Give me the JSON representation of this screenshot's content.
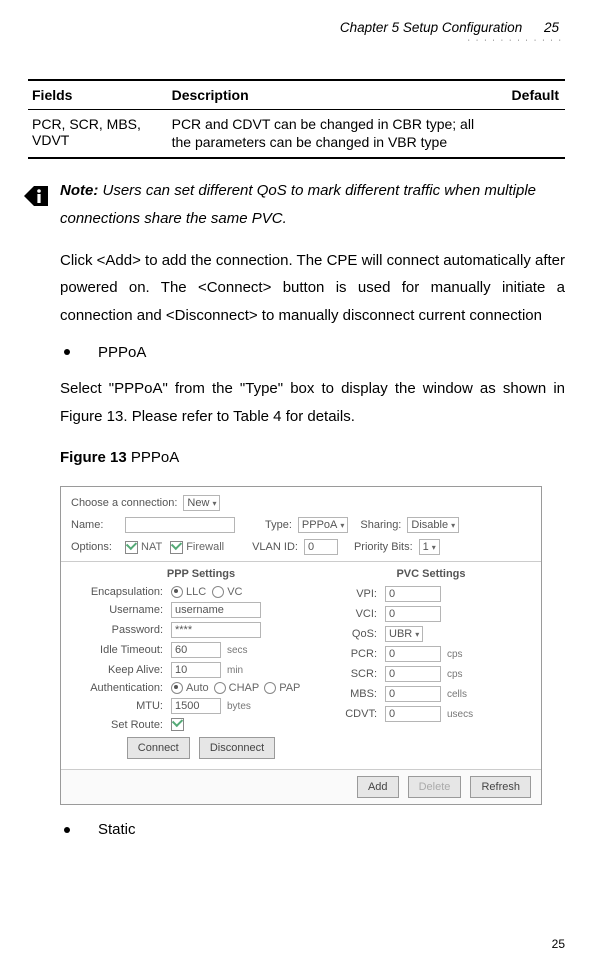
{
  "header": {
    "chapter": "Chapter 5 Setup Configuration",
    "page": "25"
  },
  "table": {
    "headers": {
      "fields": "Fields",
      "description": "Description",
      "default": "Default"
    },
    "row": {
      "fields": "PCR, SCR, MBS, VDVT",
      "description": "PCR and CDVT can be changed in CBR type; all the parameters can be changed in VBR type",
      "default": ""
    }
  },
  "note": {
    "label": "Note:",
    "text": "Users can set different QoS to mark different traffic when multiple connections share the same PVC."
  },
  "para1": "Click <Add> to add the connection. The CPE will connect automatically after powered on. The <Connect> button is used for manually initiate a connection and <Disconnect> to manually disconnect current connection",
  "bullets": {
    "pppoa": "PPPoA",
    "static": "Static"
  },
  "para2": "Select \"PPPoA\" from the \"Type\" box to display the window as shown in Figure 13. Please refer to Table 4 for details.",
  "figure": {
    "label": "Figure 13",
    "name": "PPPoA"
  },
  "shot": {
    "choose": "Choose a connection:",
    "new": "New",
    "name": "Name:",
    "type": "Type:",
    "type_val": "PPPoA",
    "sharing": "Sharing:",
    "sharing_val": "Disable",
    "options": "Options:",
    "nat": "NAT",
    "firewall": "Firewall",
    "vlanid": "VLAN ID:",
    "vlanid_val": "0",
    "priobits": "Priority Bits:",
    "priobits_val": "1",
    "ppp_hdr": "PPP Settings",
    "pvc_hdr": "PVC Settings",
    "encap": "Encapsulation:",
    "llc": "LLC",
    "vc": "VC",
    "user": "Username:",
    "user_val": "username",
    "pass": "Password:",
    "pass_val": "****",
    "idle": "Idle Timeout:",
    "idle_val": "60",
    "idle_unit": "secs",
    "keep": "Keep Alive:",
    "keep_val": "10",
    "keep_unit": "min",
    "auth": "Authentication:",
    "auto": "Auto",
    "chap": "CHAP",
    "pap": "PAP",
    "mtu": "MTU:",
    "mtu_val": "1500",
    "mtu_unit": "bytes",
    "setroute": "Set Route:",
    "vpi": "VPI:",
    "vpi_val": "0",
    "vci": "VCI:",
    "vci_val": "0",
    "qos": "QoS:",
    "qos_val": "UBR",
    "pcr": "PCR:",
    "pcr_val": "0",
    "pcr_unit": "cps",
    "scr": "SCR:",
    "scr_val": "0",
    "scr_unit": "cps",
    "mbs": "MBS:",
    "mbs_val": "0",
    "mbs_unit": "cells",
    "cdvt": "CDVT:",
    "cdvt_val": "0",
    "cdvt_unit": "usecs",
    "btn_connect": "Connect",
    "btn_disconnect": "Disconnect",
    "btn_add": "Add",
    "btn_delete": "Delete",
    "btn_refresh": "Refresh"
  },
  "footer_page": "25"
}
